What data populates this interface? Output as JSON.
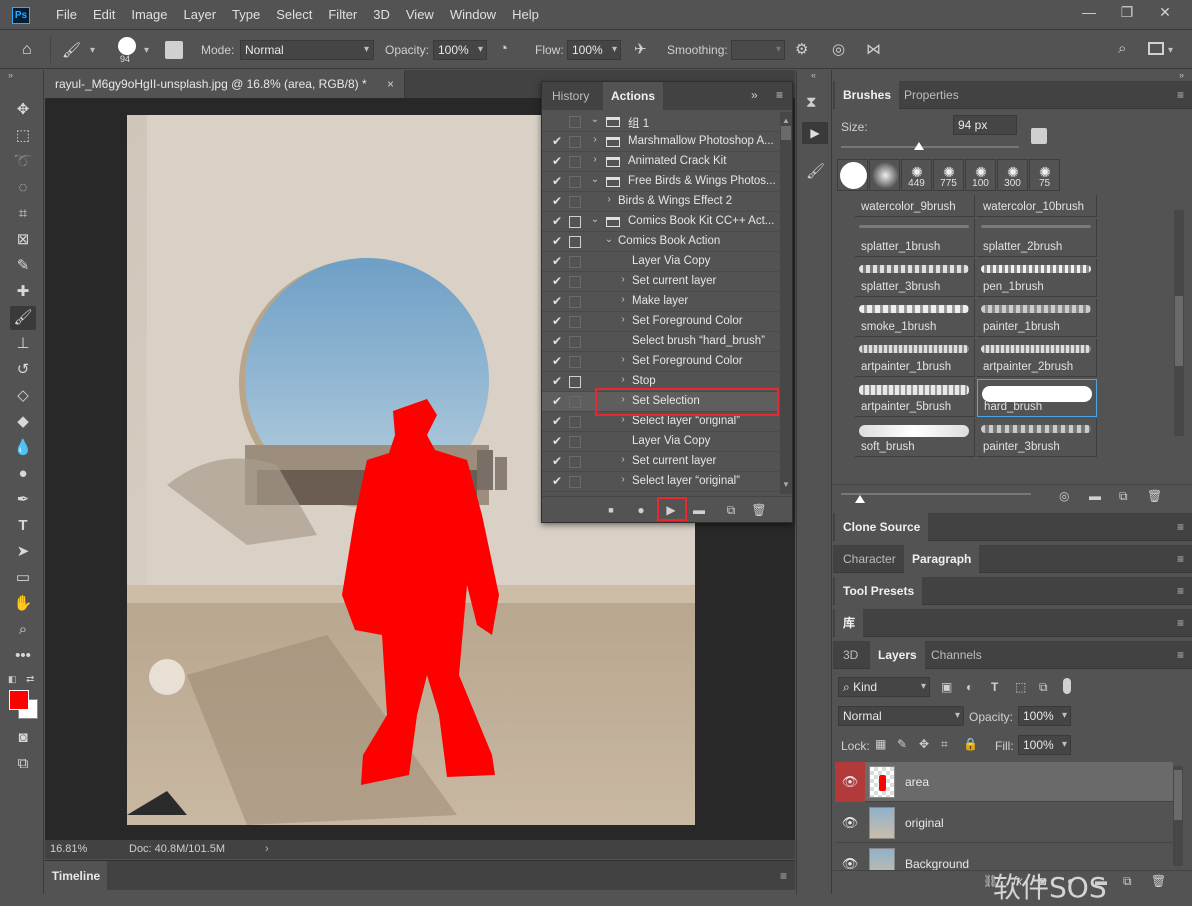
{
  "app": {
    "logo": "Ps",
    "menus": [
      "File",
      "Edit",
      "Image",
      "Layer",
      "Type",
      "Select",
      "Filter",
      "3D",
      "View",
      "Window",
      "Help"
    ]
  },
  "options": {
    "brush_size": "94",
    "mode_label": "Mode:",
    "mode_value": "Normal",
    "opacity_label": "Opacity:",
    "opacity_value": "100%",
    "flow_label": "Flow:",
    "flow_value": "100%",
    "smoothing_label": "Smoothing:",
    "smoothing_value": ""
  },
  "document": {
    "tab_title": "rayul-_M6gy9oHgII-unsplash.jpg @ 16.8% (area, RGB/8) *",
    "close": "×",
    "zoom": "16.81%",
    "doc_info": "Doc: 40.8M/101.5M"
  },
  "timeline": {
    "label": "Timeline"
  },
  "actions_panel": {
    "tabs": [
      "History",
      "Actions"
    ],
    "collapse": "»",
    "rows": [
      {
        "text": "组 1",
        "check": false,
        "dialog": false,
        "level": 0,
        "folder": true,
        "expanded": true
      },
      {
        "text": "Marshmallow Photoshop A...",
        "check": true,
        "dialog": false,
        "level": 0,
        "folder": true,
        "expanded": false
      },
      {
        "text": "Animated Crack Kit",
        "check": true,
        "dialog": false,
        "level": 0,
        "folder": true,
        "expanded": false
      },
      {
        "text": "Free Birds & Wings Photos...",
        "check": true,
        "dialog": false,
        "level": 0,
        "folder": true,
        "expanded": true
      },
      {
        "text": "Birds & Wings Effect 2",
        "check": true,
        "dialog": false,
        "level": 1,
        "folder": false,
        "expanded": false
      },
      {
        "text": "Comics Book Kit CC++ Act...",
        "check": true,
        "dialog": true,
        "level": 0,
        "folder": true,
        "expanded": true
      },
      {
        "text": "Comics Book Action",
        "check": true,
        "dialog": true,
        "level": 1,
        "folder": false,
        "expanded": true
      },
      {
        "text": "Layer Via Copy",
        "check": true,
        "dialog": false,
        "level": 2,
        "folder": false,
        "expanded": null
      },
      {
        "text": "Set current layer",
        "check": true,
        "dialog": false,
        "level": 2,
        "folder": false,
        "expanded": false
      },
      {
        "text": "Make layer",
        "check": true,
        "dialog": false,
        "level": 2,
        "folder": false,
        "expanded": false
      },
      {
        "text": "Set Foreground Color",
        "check": true,
        "dialog": false,
        "level": 2,
        "folder": false,
        "expanded": false
      },
      {
        "text": "Select brush “hard_brush”",
        "check": true,
        "dialog": false,
        "level": 2,
        "folder": false,
        "expanded": null
      },
      {
        "text": "Set Foreground Color",
        "check": true,
        "dialog": false,
        "level": 2,
        "folder": false,
        "expanded": false
      },
      {
        "text": "Stop",
        "check": true,
        "dialog": true,
        "level": 2,
        "folder": false,
        "expanded": false
      },
      {
        "text": "Set Selection",
        "check": true,
        "dialog": false,
        "level": 2,
        "folder": false,
        "expanded": false
      },
      {
        "text": "Select layer “original”",
        "check": true,
        "dialog": false,
        "level": 2,
        "folder": false,
        "expanded": false
      },
      {
        "text": "Layer Via Copy",
        "check": true,
        "dialog": false,
        "level": 2,
        "folder": false,
        "expanded": null
      },
      {
        "text": "Set current layer",
        "check": true,
        "dialog": false,
        "level": 2,
        "folder": false,
        "expanded": false
      },
      {
        "text": "Select layer “original”",
        "check": true,
        "dialog": false,
        "level": 2,
        "folder": false,
        "expanded": false
      }
    ],
    "selected_index": 14
  },
  "brushes_panel": {
    "tabs": [
      "Brushes",
      "Properties"
    ],
    "size_label": "Size:",
    "size_value": "94 px",
    "presets": [
      {
        "num": ""
      },
      {
        "num": ""
      },
      {
        "num": "449"
      },
      {
        "num": "775"
      },
      {
        "num": "100"
      },
      {
        "num": "300"
      },
      {
        "num": "75"
      }
    ],
    "brushes": [
      {
        "name": "watercolor_9brush"
      },
      {
        "name": "watercolor_10brush"
      },
      {
        "name": "splatter_1brush"
      },
      {
        "name": "splatter_2brush"
      },
      {
        "name": "splatter_3brush"
      },
      {
        "name": "pen_1brush"
      },
      {
        "name": "smoke_1brush"
      },
      {
        "name": "painter_1brush"
      },
      {
        "name": "artpainter_1brush"
      },
      {
        "name": "artpainter_2brush"
      },
      {
        "name": "artpainter_5brush"
      },
      {
        "name": "hard_brush"
      },
      {
        "name": "soft_brush"
      },
      {
        "name": "painter_3brush"
      }
    ],
    "selected_brush": "hard_brush"
  },
  "collapsed_panels": {
    "clone_source": "Clone Source",
    "character": "Character",
    "paragraph": "Paragraph",
    "tool_presets": "Tool Presets",
    "library": "库"
  },
  "layers_panel": {
    "tabs": [
      "3D",
      "Layers",
      "Channels"
    ],
    "kind_label": "Kind",
    "blend_mode": "Normal",
    "opacity_label": "Opacity:",
    "opacity_value": "100%",
    "lock_label": "Lock:",
    "fill_label": "Fill:",
    "fill_value": "100%",
    "layers": [
      {
        "name": "area",
        "selected": true
      },
      {
        "name": "original",
        "selected": false
      },
      {
        "name": "Background",
        "selected": false
      }
    ]
  },
  "watermark": "软件SOS",
  "colors": {
    "accent_red": "#e8282c",
    "foreground": "#ff0000",
    "background": "#ffffff",
    "selection_blue": "#4aa6e8"
  }
}
